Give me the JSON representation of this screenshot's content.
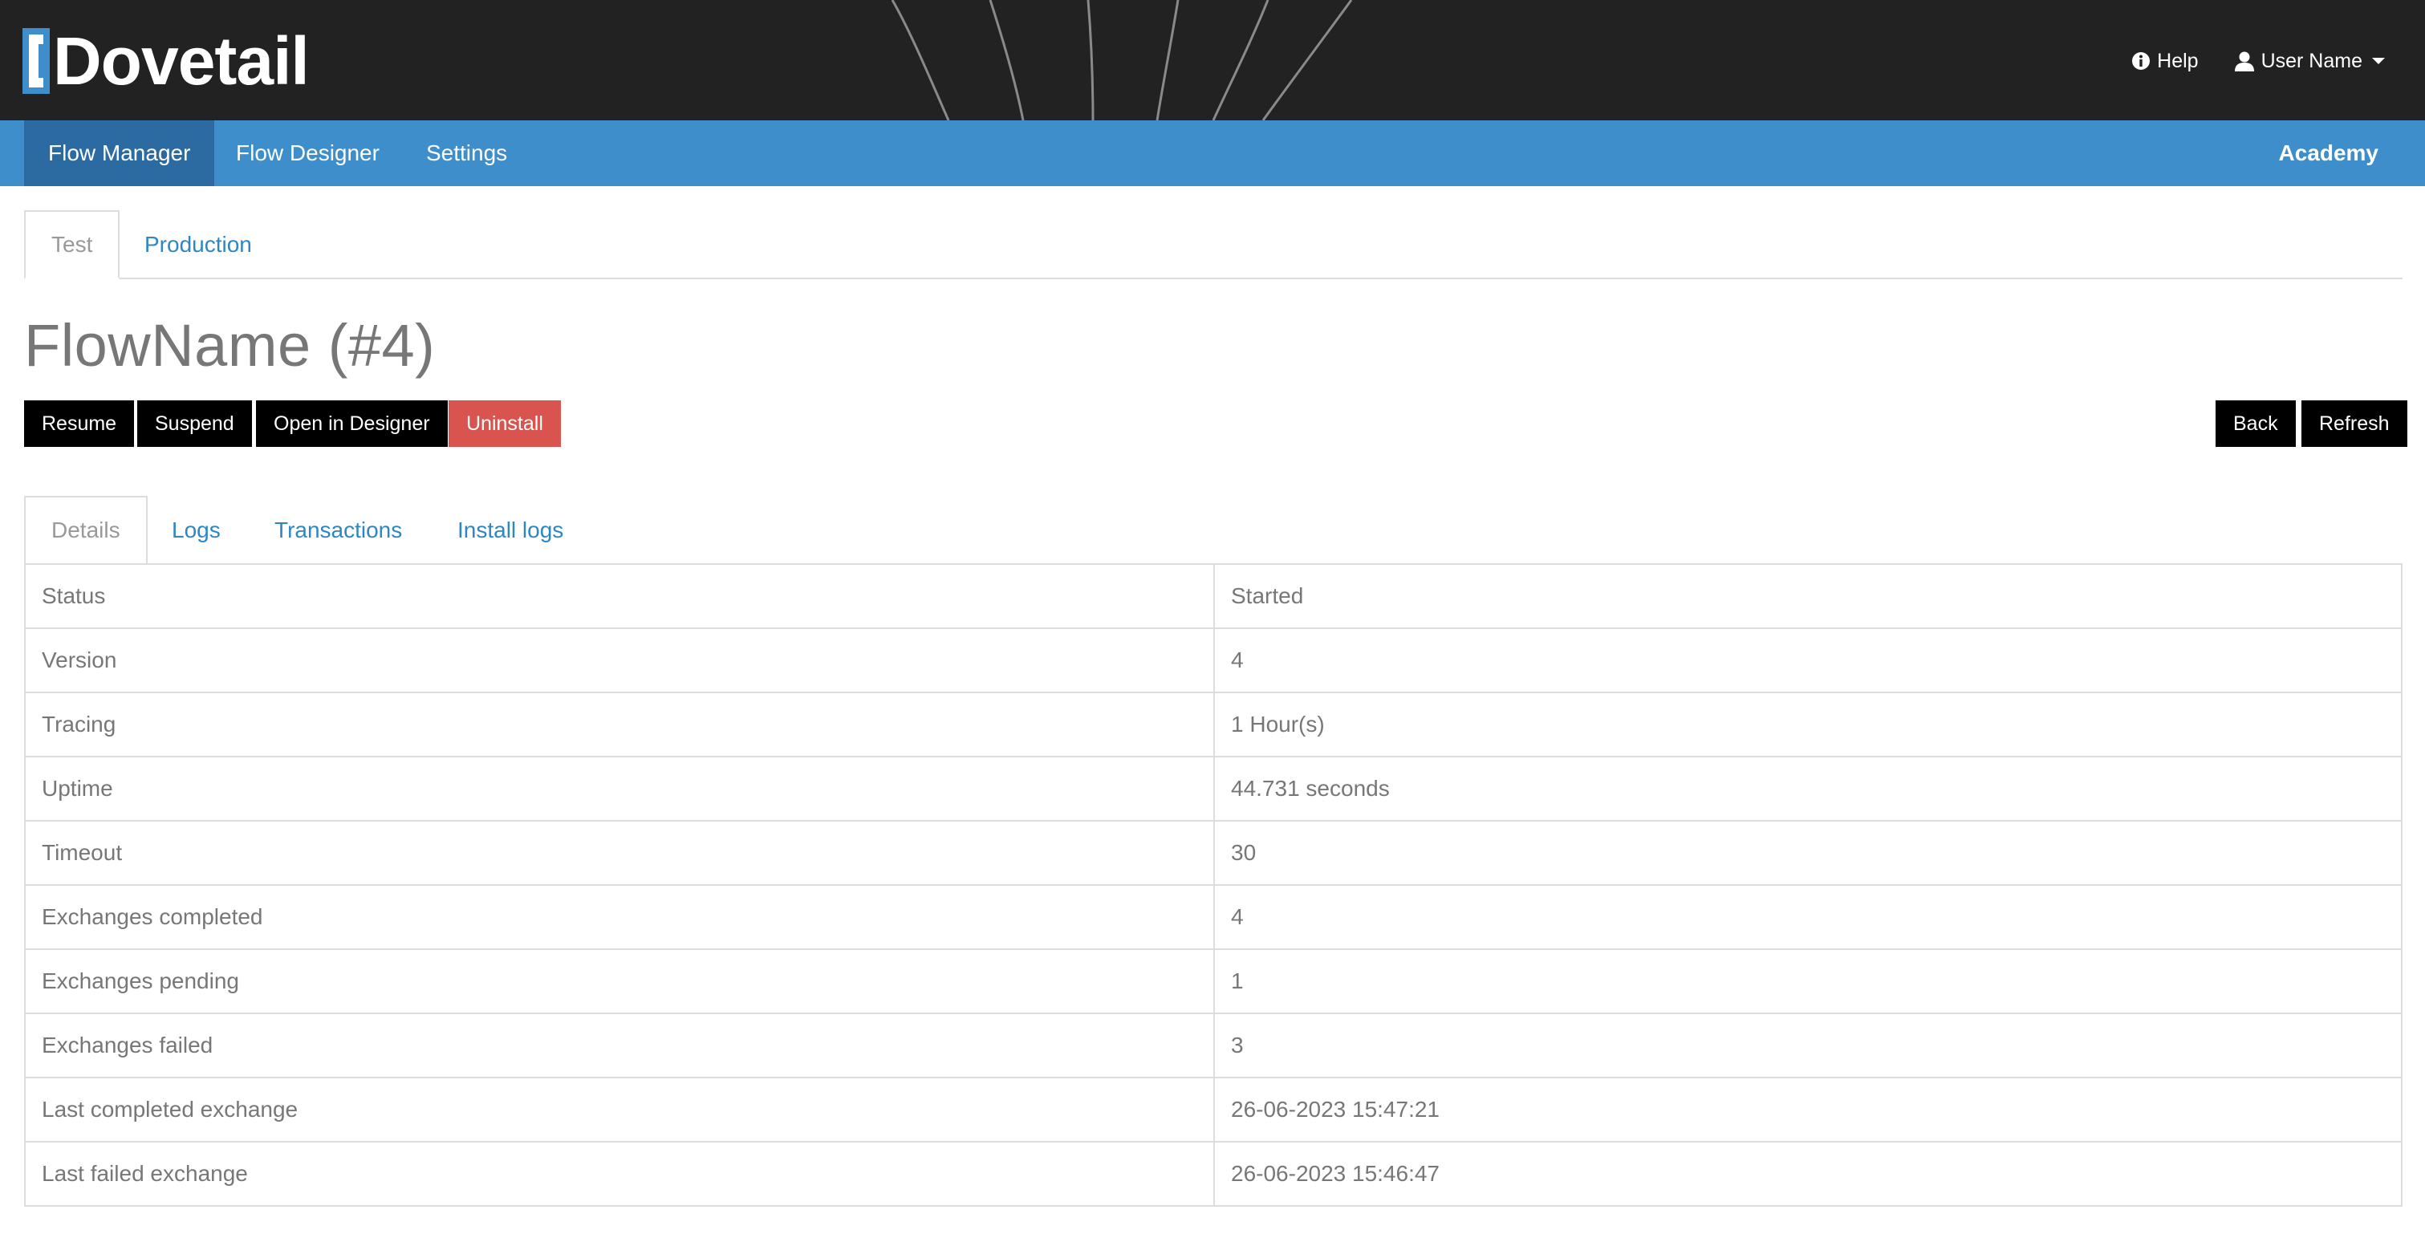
{
  "header": {
    "logo_text": "Dovetail",
    "help_label": "Help",
    "user_label": "User Name",
    "icons": {
      "help": "info-circle-icon",
      "user": "user-icon",
      "dropdown": "caret-down-icon"
    },
    "colors": {
      "background": "#222222",
      "logo_accent": "#3e8ecc"
    }
  },
  "nav": {
    "items": [
      {
        "label": "Flow Manager",
        "active": true
      },
      {
        "label": "Flow Designer",
        "active": false
      },
      {
        "label": "Settings",
        "active": false
      }
    ],
    "right_label": "Academy",
    "colors": {
      "background": "#3e8ecc",
      "active": "#2b6ba1"
    }
  },
  "env_tabs": [
    {
      "label": "Test",
      "active": true
    },
    {
      "label": "Production",
      "active": false
    }
  ],
  "page_title": "FlowName (#4)",
  "actions": {
    "resume": "Resume",
    "suspend": "Suspend",
    "open_designer": "Open in Designer",
    "uninstall": "Uninstall",
    "back": "Back",
    "refresh": "Refresh",
    "colors": {
      "default": "#000000",
      "danger": "#d9534f"
    }
  },
  "detail_tabs": [
    {
      "label": "Details",
      "active": true
    },
    {
      "label": "Logs",
      "active": false
    },
    {
      "label": "Transactions",
      "active": false
    },
    {
      "label": "Install logs",
      "active": false
    }
  ],
  "details": [
    {
      "key": "Status",
      "value": "Started"
    },
    {
      "key": "Version",
      "value": "4"
    },
    {
      "key": "Tracing",
      "value": "1 Hour(s)"
    },
    {
      "key": "Uptime",
      "value": "44.731 seconds"
    },
    {
      "key": "Timeout",
      "value": "30"
    },
    {
      "key": "Exchanges completed",
      "value": "4"
    },
    {
      "key": "Exchanges pending",
      "value": "1"
    },
    {
      "key": "Exchanges failed",
      "value": "3"
    },
    {
      "key": "Last completed exchange",
      "value": "26-06-2023 15:47:21"
    },
    {
      "key": "Last failed exchange",
      "value": "26-06-2023 15:46:47"
    }
  ]
}
